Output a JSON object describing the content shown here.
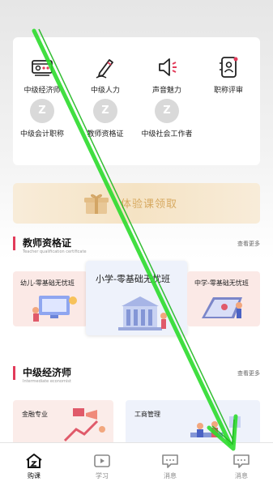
{
  "categories": [
    {
      "label": "中级经济师",
      "icon": "money-icon"
    },
    {
      "label": "中级人力",
      "icon": "pen-icon"
    },
    {
      "label": "声音魅力",
      "icon": "speaker-icon"
    },
    {
      "label": "职称评审",
      "icon": "id-card-icon"
    },
    {
      "label": "中级会计职称",
      "icon": "placeholder-z-icon",
      "glyph": "Z"
    },
    {
      "label": "教师资格证",
      "icon": "placeholder-z-icon",
      "glyph": "Z"
    },
    {
      "label": "中级社会工作者",
      "icon": "placeholder-z-icon",
      "glyph": "Z"
    }
  ],
  "promo": {
    "label": "体验课领取"
  },
  "sections": [
    {
      "title": "教师资格证",
      "subtitle": "Teacher qualification certificate",
      "more": "查看更多",
      "courses": [
        "幼儿-零基础无忧班",
        "小学-零基础无忧班",
        "中学-零基础无忧班"
      ]
    },
    {
      "title": "中级经济师",
      "subtitle": "Intermediate economist",
      "more": "查看更多",
      "courses": [
        "金融专业",
        "工商管理"
      ]
    }
  ],
  "tabs": [
    {
      "label": "购课",
      "icon": "home-icon",
      "active": true
    },
    {
      "label": "学习",
      "icon": "play-icon",
      "active": false
    },
    {
      "label": "消息",
      "icon": "message-icon",
      "active": false
    },
    {
      "label": "消息",
      "icon": "message-icon",
      "active": false
    }
  ],
  "colors": {
    "accent": "#e23b5a",
    "promo_text": "#d7a960",
    "overlay_arrow": "#2ddc2d"
  }
}
